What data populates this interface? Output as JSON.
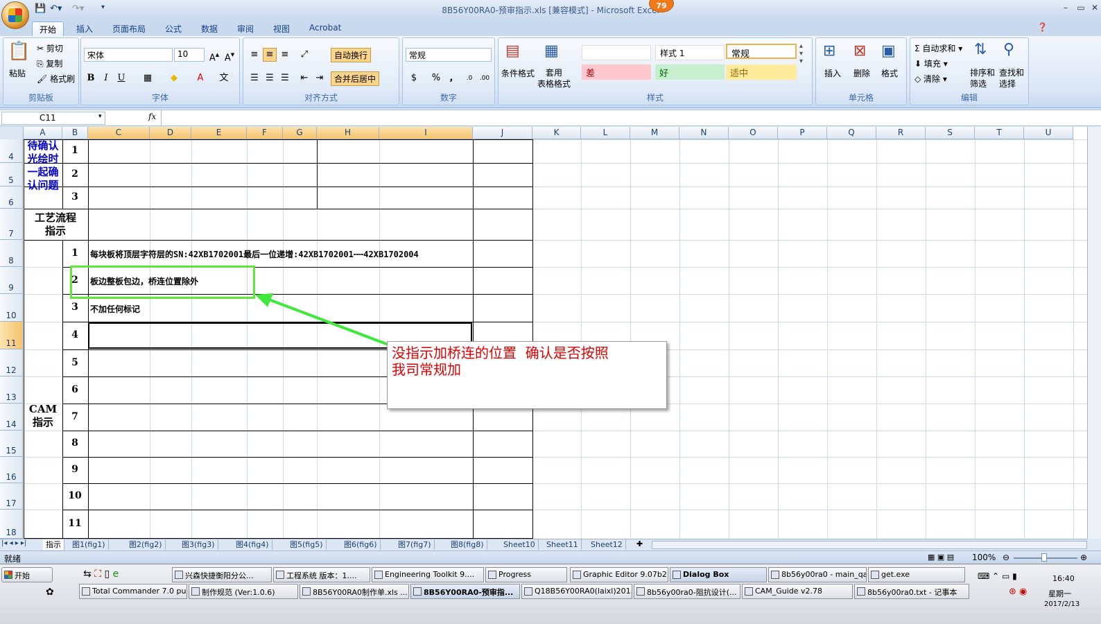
{
  "window": {
    "title": "8B56Y00RA0-预审指示.xls  [兼容模式] - Microsoft Excel",
    "badge": "79"
  },
  "tabs": [
    "开始",
    "插入",
    "页面布局",
    "公式",
    "数据",
    "审阅",
    "视图",
    "Acrobat"
  ],
  "ribbon": {
    "clipboard": {
      "paste": "粘贴",
      "cut": "剪切",
      "copy": "复制",
      "format_painter": "格式刷",
      "label": "剪贴板"
    },
    "font": {
      "name": "宋体",
      "size": "10",
      "label": "字体",
      "bold": "B",
      "italic": "I",
      "underline": "U"
    },
    "align": {
      "wrap": "自动换行",
      "merge": "合并后居中",
      "label": "对齐方式"
    },
    "number": {
      "format": "常规",
      "label": "数字",
      "percent": "%",
      "comma": ","
    },
    "styles": {
      "cond": "条件格式",
      "table": "套用\n表格格式",
      "cells": [
        "",
        "样式 1",
        "常规",
        "差",
        "好",
        "适中"
      ],
      "label": "样式"
    },
    "cells": {
      "insert": "插入",
      "delete": "删除",
      "format": "格式",
      "label": "单元格"
    },
    "edit": {
      "autosum": "自动求和",
      "fill": "填充",
      "clear": "清除",
      "sort": "排序和\n筛选",
      "find": "查找和\n选择",
      "label": "编辑"
    }
  },
  "formula_bar": {
    "cell_ref": "C11",
    "fx": "fx",
    "value": ""
  },
  "columns": [
    "A",
    "B",
    "C",
    "D",
    "E",
    "F",
    "G",
    "H",
    "I",
    "J",
    "K",
    "L",
    "M",
    "N",
    "O",
    "P",
    "Q",
    "R",
    "S",
    "T",
    "U"
  ],
  "rows": [
    "4",
    "5",
    "6",
    "7",
    "8",
    "9",
    "10",
    "11",
    "12",
    "13",
    "14",
    "15",
    "16",
    "17",
    "18"
  ],
  "sheet": {
    "confirm_label": "待确认\n光绘时\n一起确\n认问题",
    "process_label": "工艺流程\n指示",
    "cam_label": "CAM\n指示",
    "confirm_nums": [
      "1",
      "2",
      "3"
    ],
    "cam_nums": [
      "1",
      "2",
      "3",
      "4",
      "5",
      "6",
      "7",
      "8",
      "9",
      "10",
      "11"
    ],
    "cam_text": [
      "每块板将顶层字符层的SN:42XB1702001最后一位递增:42XB1702001┅┅42XB1702004",
      "板边整板包边，桥连位置除外",
      "不加任何标记"
    ]
  },
  "callout": {
    "text": "没指示加桥连的位置  确认是否按照\n我司常规加",
    "color": "#e00000"
  },
  "sheet_tabs": [
    "指示",
    "图1(fig1)",
    "图2(fig2)",
    "图3(fig3)",
    "图4(fig4)",
    "图5(fig5)",
    "图6(fig6)",
    "图7(fig7)",
    "图8(fig8)",
    "Sheet10",
    "Sheet11",
    "Sheet12"
  ],
  "status": {
    "ready": "就绪",
    "zoom": "100%"
  },
  "taskbar": {
    "start": "开始",
    "row1": [
      "兴森快捷衡阳分公...",
      "工程系统  版本：1....",
      "Engineering Toolkit 9....",
      "Progress",
      "Graphic Editor 9.07b2...",
      "Dialog Box",
      "8b56y00ra0 - main_qa",
      "get.exe"
    ],
    "row2": [
      "Total Commander 7.0 pu...",
      "制作规范 (Ver:1.0.6)",
      "8B56Y00RA0制作单.xls ...",
      "8B56Y00RA0-预审指...",
      "Q18B56Y00RA0(laixl)201...",
      "8b56y00ra0-阻抗设计(...",
      "CAM_Guide v2.78",
      "8b56y00ra0.txt - 记事本"
    ],
    "time": "16:40",
    "day": "星期一",
    "date": "2017/2/13"
  }
}
